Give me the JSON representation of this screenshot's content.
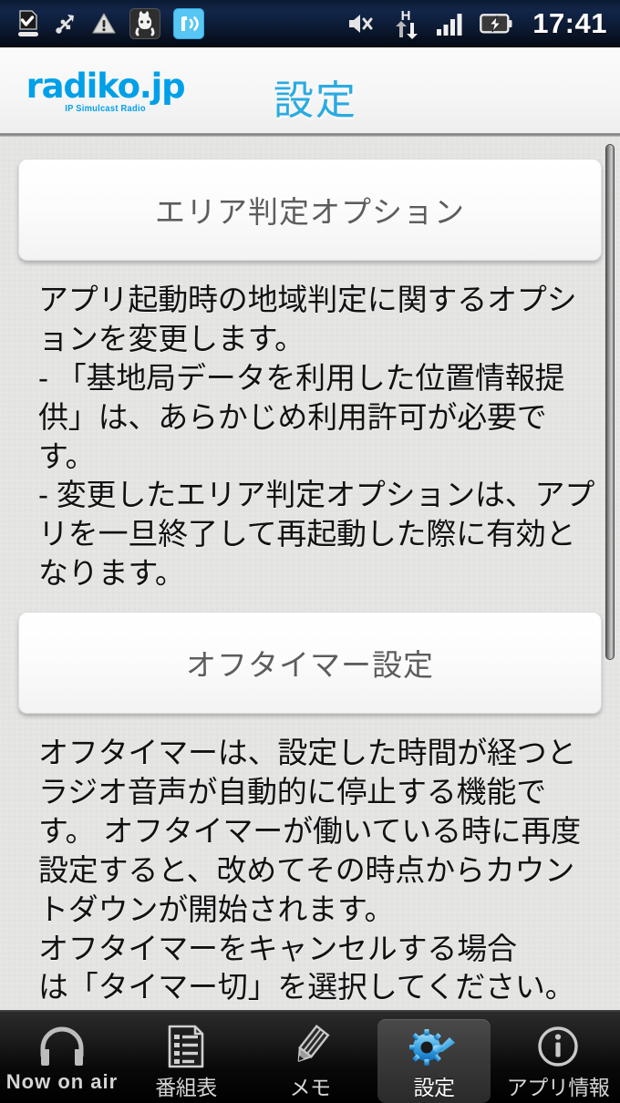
{
  "statusbar": {
    "clock": "17:41",
    "left_icons": [
      {
        "name": "download-complete-icon",
        "label": "download complete"
      },
      {
        "name": "usb-icon",
        "label": "USB connected"
      },
      {
        "name": "warning-icon",
        "label": "warning"
      },
      {
        "name": "app-notification-icon",
        "label": "app notification"
      },
      {
        "name": "radiko-notification-icon",
        "label": "radiko playing"
      }
    ],
    "right_icons": [
      {
        "name": "volume-mute-icon",
        "label": "silent mode"
      },
      {
        "name": "hspa-data-icon",
        "label": "H",
        "sub": "data transfer"
      },
      {
        "name": "signal-bars-icon",
        "label": "signal strength"
      },
      {
        "name": "battery-charging-icon",
        "label": "battery charging"
      }
    ]
  },
  "header": {
    "logo_main": "radiko.jp",
    "logo_tagline": "IP Simulcast Radio",
    "title": "設定",
    "logo_color": "#00a0e9",
    "title_color": "#29abe2"
  },
  "content": {
    "sections": [
      {
        "header": "エリア判定オプション",
        "body": "アプリ起動時の地域判定に関するオプションを変更します。\n- 「基地局データを利用した位置情報提供」は、あらかじめ利用許可が必要です。\n- 変更したエリア判定オプションは、アプリを一旦終了して再起動した際に有効となります。"
      },
      {
        "header": "オフタイマー設定",
        "body": "オフタイマーは、設定した時間が経つとラジオ音声が自動的に停止する機能です。 オフタイマーが働いている時に再度設定すると、改めてその時点からカウントダウンが開始されます。\nオフタイマーをキャンセルする場合\nは「タイマー切」を選択してください。"
      }
    ]
  },
  "tabbar": {
    "items": [
      {
        "label": "Now on air",
        "icon": "headphones-icon",
        "active": false
      },
      {
        "label": "番組表",
        "icon": "program-list-icon",
        "active": false
      },
      {
        "label": "メモ",
        "icon": "pencil-memo-icon",
        "active": false
      },
      {
        "label": "設定",
        "icon": "settings-gear-wrench-icon",
        "active": true
      },
      {
        "label": "アプリ情報",
        "icon": "info-circle-icon",
        "active": false
      }
    ],
    "active_accent": "#3b9fe0"
  }
}
